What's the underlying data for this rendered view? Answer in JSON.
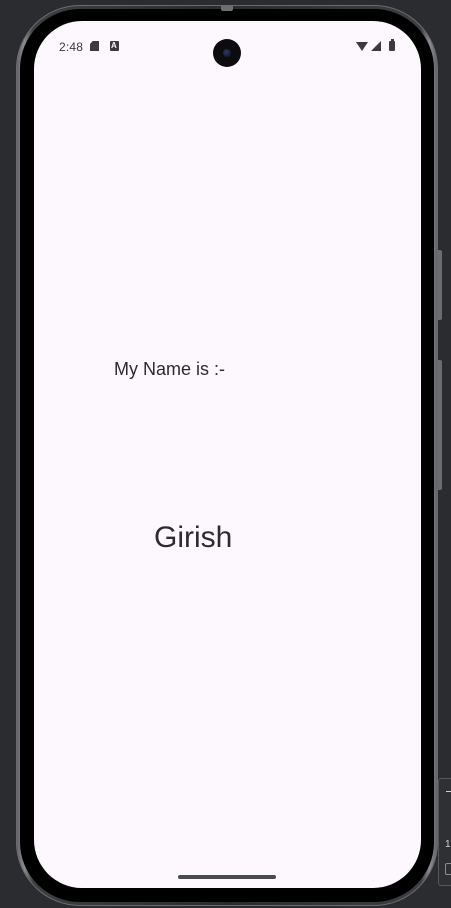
{
  "status_bar": {
    "time": "2:48",
    "icons": [
      "sd-card-icon",
      "auto-icon",
      "front-camera-icon",
      "wifi-icon",
      "cellular-signal-icon",
      "battery-icon"
    ]
  },
  "content": {
    "label": "My Name is :-",
    "name": "Girish"
  },
  "emulator_panel": {
    "partial_text": "1"
  },
  "colors": {
    "screen_background": "#fdf7fe",
    "text": "#2d2b31",
    "desktop_background": "#2b2c30"
  }
}
